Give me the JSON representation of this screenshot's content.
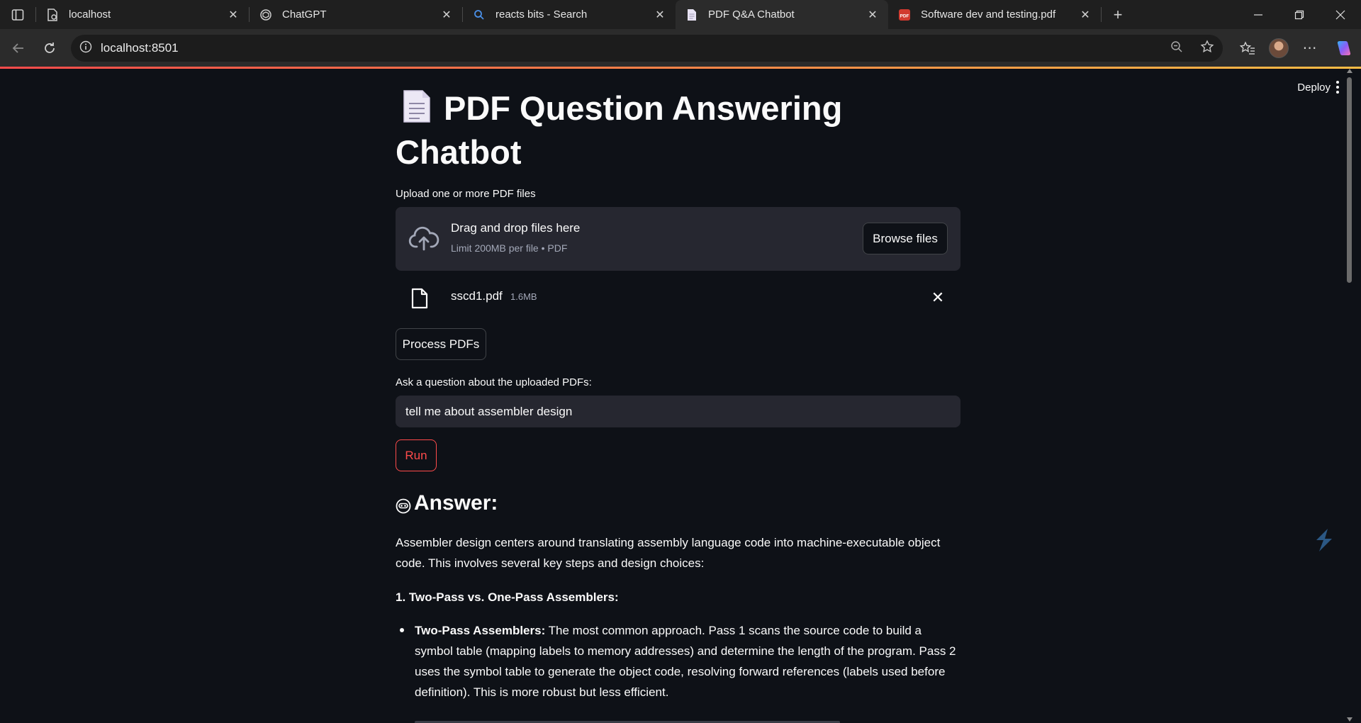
{
  "browser": {
    "tabs": [
      {
        "title": "localhost",
        "icon": "page-icon",
        "active": false
      },
      {
        "title": "ChatGPT",
        "icon": "chatgpt-icon",
        "active": false
      },
      {
        "title": "reacts bits - Search",
        "icon": "search-icon",
        "active": false
      },
      {
        "title": "PDF Q&A Chatbot",
        "icon": "doc-icon",
        "active": true
      },
      {
        "title": "Software dev and testing.pdf",
        "icon": "pdf-icon",
        "active": false
      }
    ],
    "url": "localhost:8501"
  },
  "app": {
    "deploy_label": "Deploy",
    "title": "PDF Question Answering Chatbot",
    "upload": {
      "label": "Upload one or more PDF files",
      "drop_title": "Drag and drop files here",
      "drop_limit": "Limit 200MB per file • PDF",
      "browse_label": "Browse files"
    },
    "file": {
      "name": "sscd1.pdf",
      "size": "1.6MB"
    },
    "process_label": "Process PDFs",
    "question": {
      "label": "Ask a question about the uploaded PDFs:",
      "value": "tell me about assembler design"
    },
    "run_label": "Run",
    "answer": {
      "heading": "Answer:",
      "intro": "Assembler design centers around translating assembly language code into machine-executable object code. This involves several key steps and design choices:",
      "section1": "1. Two-Pass vs. One-Pass Assemblers:",
      "bullet1_title": "Two-Pass Assemblers:",
      "bullet1_text": " The most common approach. Pass 1 scans the source code to build a symbol table (mapping labels to memory addresses) and determine the length of the program. Pass 2 uses the symbol table to generate the object code, resolving forward references (labels used before definition). This is more robust but less efficient."
    }
  },
  "colors": {
    "background": "#0e1117",
    "widget": "#262730",
    "accent": "#ff4b4b",
    "muted_text": "#a3a8b8"
  }
}
